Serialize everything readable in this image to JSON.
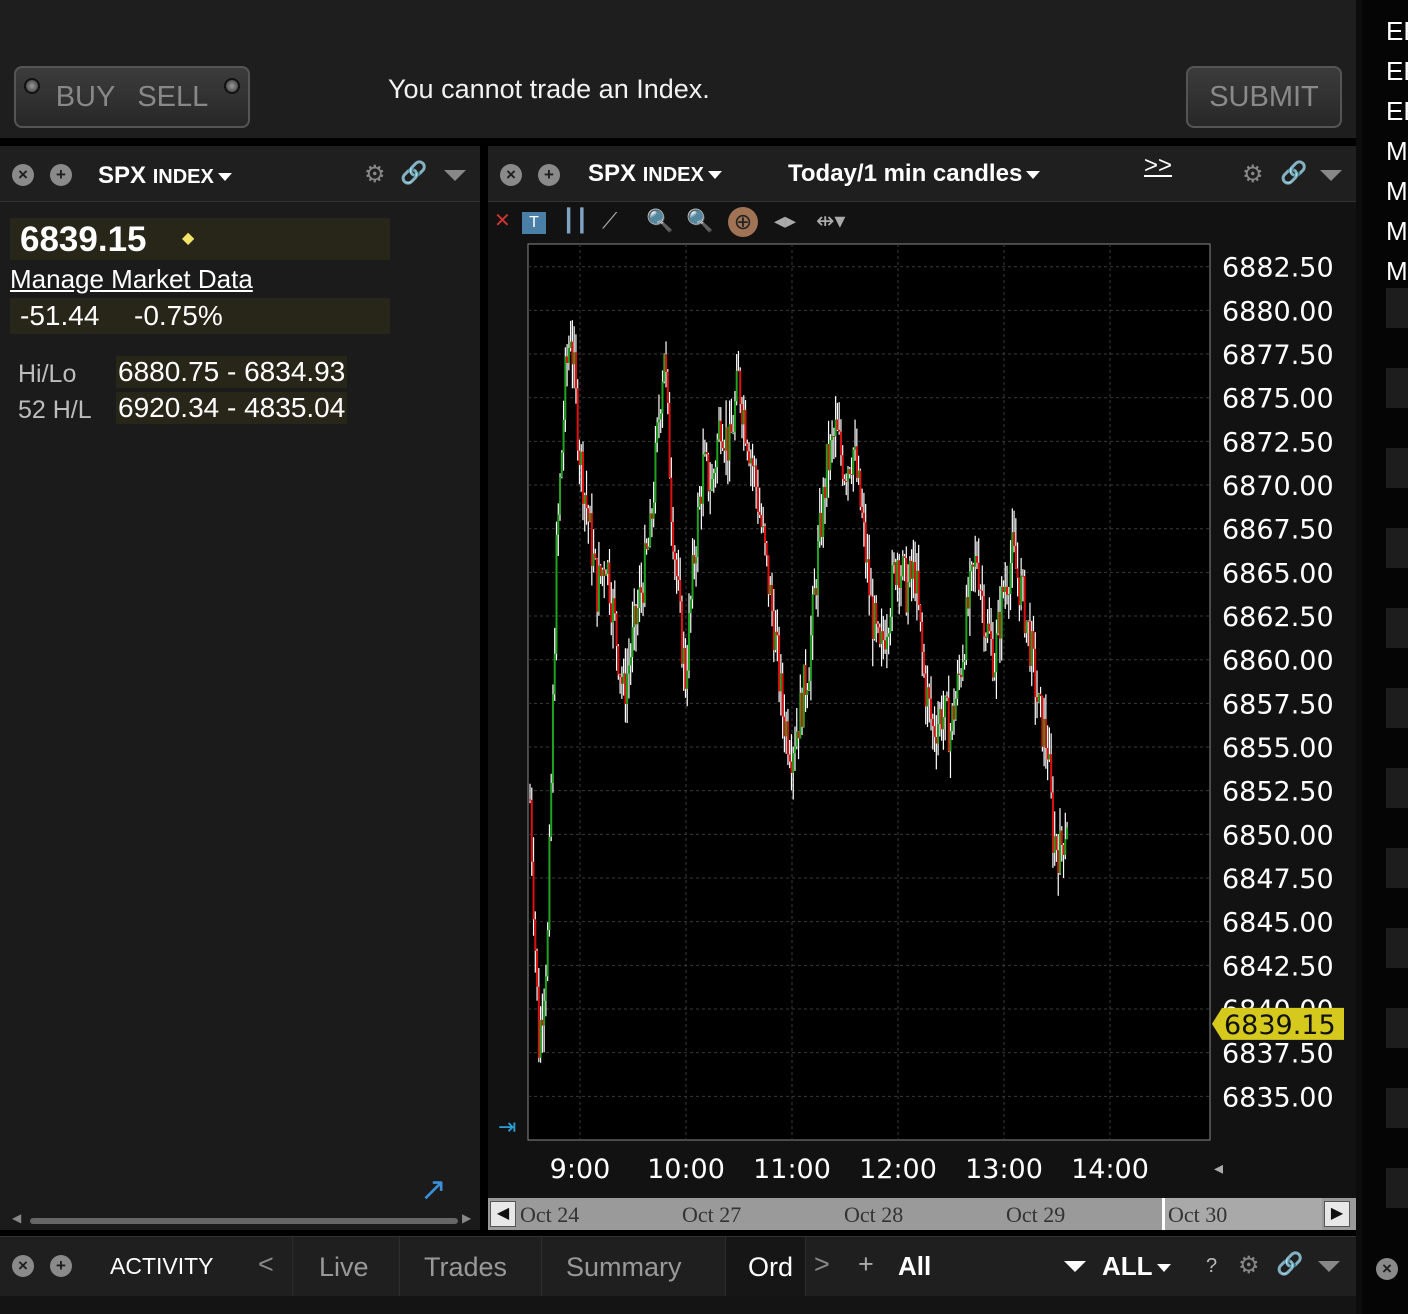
{
  "order_bar": {
    "buy_label": "BUY",
    "sell_label": "SELL",
    "message": "You cannot trade an Index.",
    "submit_label": "SUBMIT"
  },
  "quote_panel": {
    "symbol": "SPX",
    "symbol_suffix": "INDEX",
    "last_price": "6839.15",
    "manage_market_data": "Manage Market Data",
    "change": "-51.44",
    "change_pct": "-0.75%",
    "hilo_label": "Hi/Lo",
    "hilo_high": "6880.75",
    "hilo_low": "6834.93",
    "week52_label": "52 H/L",
    "week52_high": "6920.34",
    "week52_low": "4835.04",
    "sep": "-"
  },
  "chart_panel": {
    "symbol": "SPX",
    "symbol_suffix": "INDEX",
    "period": "Today/1 min candles",
    "more": ">>",
    "timeline_labels": [
      "Oct 24",
      "Oct 27",
      "Oct 28",
      "Oct 29",
      "Oct 30"
    ]
  },
  "chart_data": {
    "type": "candlestick",
    "interval": "1 min",
    "x_ticks": [
      "9:00",
      "10:00",
      "11:00",
      "12:00",
      "13:00",
      "14:00"
    ],
    "y_ticks": [
      "6882.50",
      "6880.00",
      "6877.50",
      "6875.00",
      "6872.50",
      "6870.00",
      "6867.50",
      "6865.00",
      "6862.50",
      "6860.00",
      "6857.50",
      "6855.00",
      "6852.50",
      "6850.00",
      "6847.50",
      "6845.00",
      "6842.50",
      "6840.00",
      "6837.50",
      "6835.00"
    ],
    "ylim": [
      6832.5,
      6883.8
    ],
    "last_price_label": "6839.15",
    "up_color": "#1fa21f",
    "down_color": "#e01010",
    "grid": true,
    "close_path": [
      [
        "8:30",
        6852.0
      ],
      [
        "8:35",
        6838.0
      ],
      [
        "8:40",
        6844.0
      ],
      [
        "8:45",
        6866.0
      ],
      [
        "8:50",
        6876.0
      ],
      [
        "8:53",
        6879.0
      ],
      [
        "8:58",
        6872.0
      ],
      [
        "9:03",
        6868.0
      ],
      [
        "9:08",
        6864.0
      ],
      [
        "9:13",
        6866.0
      ],
      [
        "9:18",
        6862.0
      ],
      [
        "9:23",
        6858.0
      ],
      [
        "9:28",
        6861.0
      ],
      [
        "9:33",
        6864.0
      ],
      [
        "9:38",
        6867.0
      ],
      [
        "9:43",
        6874.0
      ],
      [
        "9:46",
        6878.0
      ],
      [
        "9:50",
        6869.0
      ],
      [
        "9:55",
        6862.0
      ],
      [
        "9:58",
        6859.0
      ],
      [
        "10:03",
        6866.0
      ],
      [
        "10:08",
        6871.0
      ],
      [
        "10:13",
        6870.0
      ],
      [
        "10:18",
        6874.0
      ],
      [
        "10:23",
        6872.0
      ],
      [
        "10:28",
        6876.0
      ],
      [
        "10:33",
        6873.0
      ],
      [
        "10:38",
        6870.0
      ],
      [
        "10:43",
        6866.0
      ],
      [
        "10:48",
        6862.0
      ],
      [
        "10:53",
        6857.0
      ],
      [
        "10:58",
        6855.0
      ],
      [
        "11:03",
        6857.0
      ],
      [
        "11:08",
        6860.0
      ],
      [
        "11:13",
        6866.0
      ],
      [
        "11:18",
        6871.0
      ],
      [
        "11:23",
        6873.0
      ],
      [
        "11:28",
        6871.0
      ],
      [
        "11:33",
        6872.0
      ],
      [
        "11:38",
        6868.0
      ],
      [
        "11:43",
        6863.0
      ],
      [
        "11:48",
        6860.0
      ],
      [
        "11:53",
        6863.0
      ],
      [
        "11:58",
        6866.0
      ],
      [
        "12:03",
        6864.0
      ],
      [
        "12:08",
        6865.0
      ],
      [
        "12:13",
        6859.0
      ],
      [
        "12:18",
        6856.0
      ],
      [
        "12:23",
        6857.0
      ],
      [
        "12:28",
        6856.0
      ],
      [
        "12:33",
        6859.0
      ],
      [
        "12:38",
        6863.0
      ],
      [
        "12:43",
        6866.0
      ],
      [
        "12:48",
        6862.0
      ],
      [
        "12:53",
        6860.0
      ],
      [
        "12:58",
        6864.0
      ],
      [
        "13:03",
        6866.0
      ],
      [
        "13:08",
        6864.0
      ],
      [
        "13:13",
        6861.0
      ],
      [
        "13:18",
        6857.0
      ],
      [
        "13:23",
        6855.0
      ],
      [
        "13:26",
        6850.0
      ],
      [
        "13:30",
        6849.0
      ],
      [
        "13:34",
        6851.0
      ]
    ]
  },
  "bottom_bar": {
    "activity": "ACTIVITY",
    "prev": "<",
    "tabs": [
      "Live",
      "Trades",
      "Summary",
      "Ord"
    ],
    "next": ">",
    "plus": "+",
    "all_filter": "All",
    "account": "ALL",
    "help": "?"
  },
  "right_strip": {
    "labels": [
      "EE",
      "EE",
      "EE",
      "M",
      "M",
      "M",
      "M"
    ]
  },
  "icons": {
    "close": "close-icon",
    "add": "add-icon",
    "settings": "gear-icon",
    "link": "link-icon",
    "menu": "triangle-menu-icon",
    "expand": "expand-arrow-icon"
  }
}
